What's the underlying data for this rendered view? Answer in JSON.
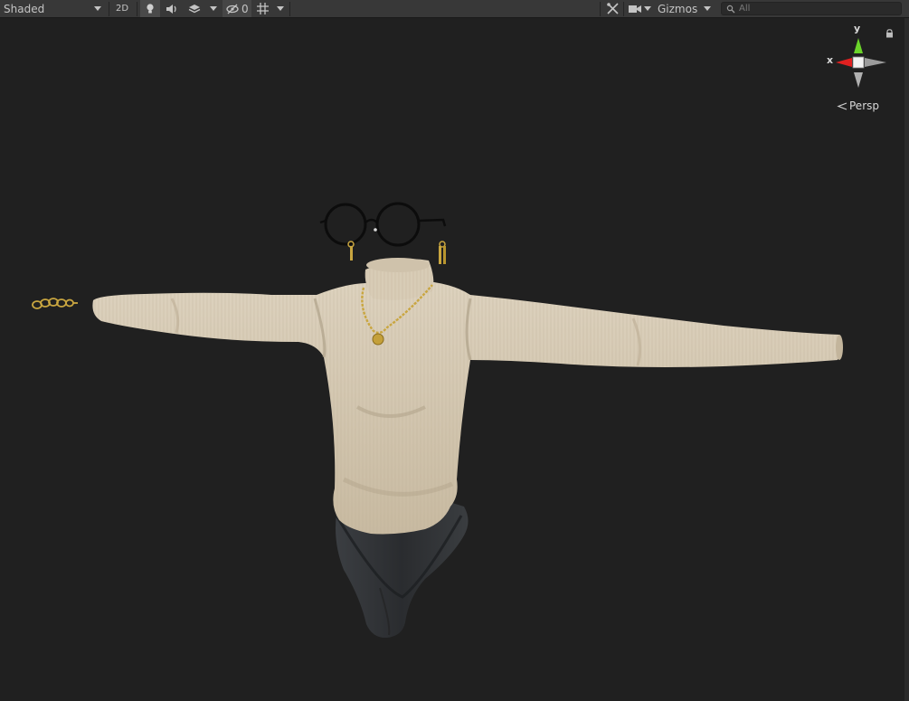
{
  "toolbar": {
    "shading_mode": "Shaded",
    "toggle_2d": "2D",
    "hidden_count": "0",
    "gizmos_label": "Gizmos",
    "search_placeholder": "All"
  },
  "scene_gizmo": {
    "axis_y": "y",
    "axis_x": "x",
    "projection": "Persp"
  },
  "icons": [
    "lighting-icon",
    "audio-icon",
    "effects-icon",
    "visibility-icon",
    "grid-icon",
    "tools-icon",
    "camera-icon",
    "search-icon",
    "lock-icon"
  ],
  "colors": {
    "toolbar_bg": "#383838",
    "viewport_bg": "#202020",
    "sweater": "#d6c9b2",
    "pants": "#2e3033",
    "gold": "#c9a640",
    "axis_y": "#6bd42a",
    "axis_x": "#e02020"
  }
}
